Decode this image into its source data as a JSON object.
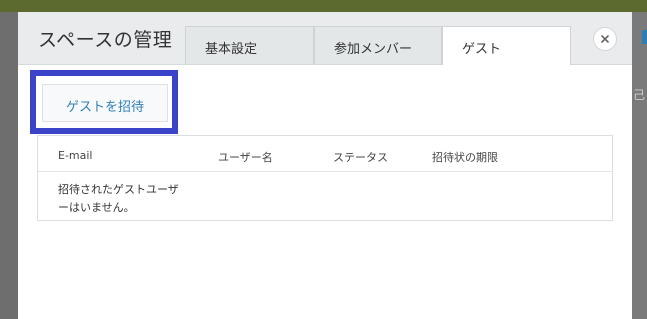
{
  "modal": {
    "title": "スペースの管理"
  },
  "tabs": [
    {
      "label": "基本設定",
      "active": false
    },
    {
      "label": "参加メンバー",
      "active": false
    },
    {
      "label": "ゲスト",
      "active": true
    }
  ],
  "close_icon": "close-icon",
  "invite_button": {
    "label": "ゲストを招待"
  },
  "guest_table": {
    "columns": [
      "E-mail",
      "ユーザー名",
      "ステータス",
      "招待状の期限"
    ],
    "empty_message": "招待されたゲストユーザーはいません。"
  },
  "background": {
    "right_glyph": "己"
  },
  "colors": {
    "highlight": "#3b44c8",
    "link": "#2f7fb7",
    "header_bg": "#e9ebec"
  }
}
